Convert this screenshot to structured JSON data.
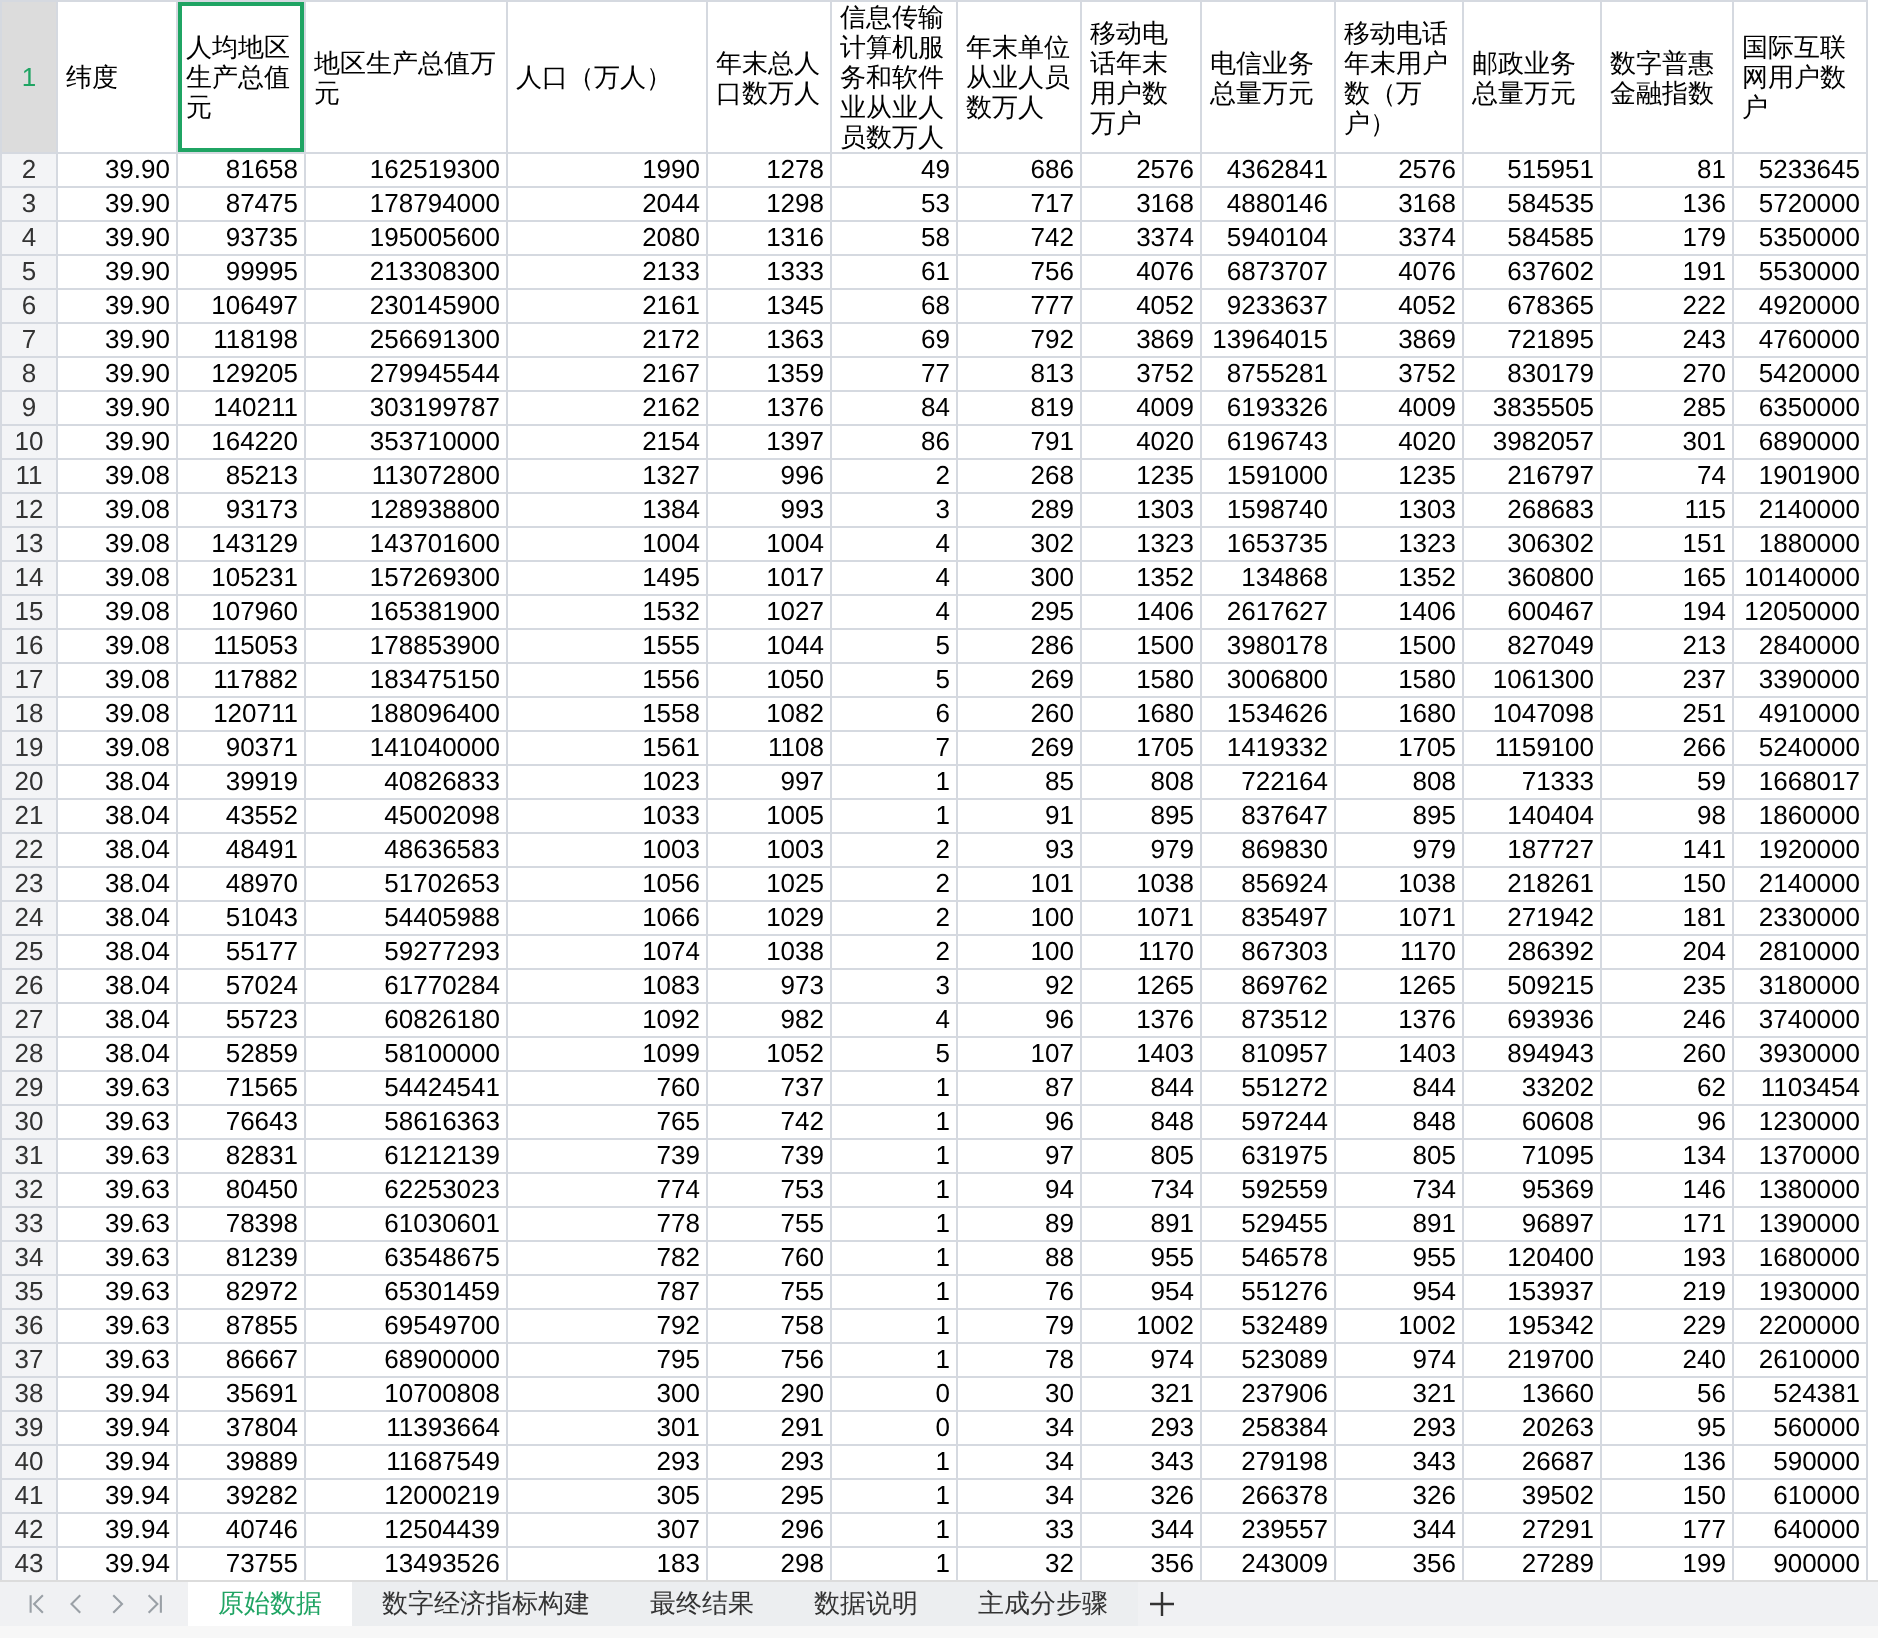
{
  "header_row": {
    "number": "1",
    "selected": true
  },
  "columns": [
    {
      "label": "纬度",
      "selected": false
    },
    {
      "label": "人均地区生产总值元",
      "selected": true
    },
    {
      "label": "地区生产总值万元",
      "selected": false
    },
    {
      "label": "人口（万人）",
      "selected": false
    },
    {
      "label": "年末总人口数万人",
      "selected": false
    },
    {
      "label": "信息传输计算机服务和软件业从业人员数万人",
      "selected": false
    },
    {
      "label": "年末单位从业人员数万人",
      "selected": false
    },
    {
      "label": "移动电话年末用户数万户",
      "selected": false
    },
    {
      "label": "电信业务总量万元",
      "selected": false
    },
    {
      "label": "移动电话年末用户数（万户）",
      "selected": false
    },
    {
      "label": "邮政业务总量万元",
      "selected": false
    },
    {
      "label": "数字普惠金融指数",
      "selected": false
    },
    {
      "label": "国际互联网用户数户",
      "selected": false
    }
  ],
  "rows": [
    {
      "number": "2",
      "cells": [
        "39.90",
        "81658",
        "162519300",
        "1990",
        "1278",
        "49",
        "686",
        "2576",
        "4362841",
        "2576",
        "515951",
        "81",
        "5233645"
      ]
    },
    {
      "number": "3",
      "cells": [
        "39.90",
        "87475",
        "178794000",
        "2044",
        "1298",
        "53",
        "717",
        "3168",
        "4880146",
        "3168",
        "584535",
        "136",
        "5720000"
      ]
    },
    {
      "number": "4",
      "cells": [
        "39.90",
        "93735",
        "195005600",
        "2080",
        "1316",
        "58",
        "742",
        "3374",
        "5940104",
        "3374",
        "584585",
        "179",
        "5350000"
      ]
    },
    {
      "number": "5",
      "cells": [
        "39.90",
        "99995",
        "213308300",
        "2133",
        "1333",
        "61",
        "756",
        "4076",
        "6873707",
        "4076",
        "637602",
        "191",
        "5530000"
      ]
    },
    {
      "number": "6",
      "cells": [
        "39.90",
        "106497",
        "230145900",
        "2161",
        "1345",
        "68",
        "777",
        "4052",
        "9233637",
        "4052",
        "678365",
        "222",
        "4920000"
      ]
    },
    {
      "number": "7",
      "cells": [
        "39.90",
        "118198",
        "256691300",
        "2172",
        "1363",
        "69",
        "792",
        "3869",
        "13964015",
        "3869",
        "721895",
        "243",
        "4760000"
      ]
    },
    {
      "number": "8",
      "cells": [
        "39.90",
        "129205",
        "279945544",
        "2167",
        "1359",
        "77",
        "813",
        "3752",
        "8755281",
        "3752",
        "830179",
        "270",
        "5420000"
      ]
    },
    {
      "number": "9",
      "cells": [
        "39.90",
        "140211",
        "303199787",
        "2162",
        "1376",
        "84",
        "819",
        "4009",
        "6193326",
        "4009",
        "3835505",
        "285",
        "6350000"
      ]
    },
    {
      "number": "10",
      "cells": [
        "39.90",
        "164220",
        "353710000",
        "2154",
        "1397",
        "86",
        "791",
        "4020",
        "6196743",
        "4020",
        "3982057",
        "301",
        "6890000"
      ]
    },
    {
      "number": "11",
      "cells": [
        "39.08",
        "85213",
        "113072800",
        "1327",
        "996",
        "2",
        "268",
        "1235",
        "1591000",
        "1235",
        "216797",
        "74",
        "1901900"
      ]
    },
    {
      "number": "12",
      "cells": [
        "39.08",
        "93173",
        "128938800",
        "1384",
        "993",
        "3",
        "289",
        "1303",
        "1598740",
        "1303",
        "268683",
        "115",
        "2140000"
      ]
    },
    {
      "number": "13",
      "cells": [
        "39.08",
        "143129",
        "143701600",
        "1004",
        "1004",
        "4",
        "302",
        "1323",
        "1653735",
        "1323",
        "306302",
        "151",
        "1880000"
      ]
    },
    {
      "number": "14",
      "cells": [
        "39.08",
        "105231",
        "157269300",
        "1495",
        "1017",
        "4",
        "300",
        "1352",
        "134868",
        "1352",
        "360800",
        "165",
        "10140000"
      ]
    },
    {
      "number": "15",
      "cells": [
        "39.08",
        "107960",
        "165381900",
        "1532",
        "1027",
        "4",
        "295",
        "1406",
        "2617627",
        "1406",
        "600467",
        "194",
        "12050000"
      ]
    },
    {
      "number": "16",
      "cells": [
        "39.08",
        "115053",
        "178853900",
        "1555",
        "1044",
        "5",
        "286",
        "1500",
        "3980178",
        "1500",
        "827049",
        "213",
        "2840000"
      ]
    },
    {
      "number": "17",
      "cells": [
        "39.08",
        "117882",
        "183475150",
        "1556",
        "1050",
        "5",
        "269",
        "1580",
        "3006800",
        "1580",
        "1061300",
        "237",
        "3390000"
      ]
    },
    {
      "number": "18",
      "cells": [
        "39.08",
        "120711",
        "188096400",
        "1558",
        "1082",
        "6",
        "260",
        "1680",
        "1534626",
        "1680",
        "1047098",
        "251",
        "4910000"
      ]
    },
    {
      "number": "19",
      "cells": [
        "39.08",
        "90371",
        "141040000",
        "1561",
        "1108",
        "7",
        "269",
        "1705",
        "1419332",
        "1705",
        "1159100",
        "266",
        "5240000"
      ]
    },
    {
      "number": "20",
      "cells": [
        "38.04",
        "39919",
        "40826833",
        "1023",
        "997",
        "1",
        "85",
        "808",
        "722164",
        "808",
        "71333",
        "59",
        "1668017"
      ]
    },
    {
      "number": "21",
      "cells": [
        "38.04",
        "43552",
        "45002098",
        "1033",
        "1005",
        "1",
        "91",
        "895",
        "837647",
        "895",
        "140404",
        "98",
        "1860000"
      ]
    },
    {
      "number": "22",
      "cells": [
        "38.04",
        "48491",
        "48636583",
        "1003",
        "1003",
        "2",
        "93",
        "979",
        "869830",
        "979",
        "187727",
        "141",
        "1920000"
      ]
    },
    {
      "number": "23",
      "cells": [
        "38.04",
        "48970",
        "51702653",
        "1056",
        "1025",
        "2",
        "101",
        "1038",
        "856924",
        "1038",
        "218261",
        "150",
        "2140000"
      ]
    },
    {
      "number": "24",
      "cells": [
        "38.04",
        "51043",
        "54405988",
        "1066",
        "1029",
        "2",
        "100",
        "1071",
        "835497",
        "1071",
        "271942",
        "181",
        "2330000"
      ]
    },
    {
      "number": "25",
      "cells": [
        "38.04",
        "55177",
        "59277293",
        "1074",
        "1038",
        "2",
        "100",
        "1170",
        "867303",
        "1170",
        "286392",
        "204",
        "2810000"
      ]
    },
    {
      "number": "26",
      "cells": [
        "38.04",
        "57024",
        "61770284",
        "1083",
        "973",
        "3",
        "92",
        "1265",
        "869762",
        "1265",
        "509215",
        "235",
        "3180000"
      ]
    },
    {
      "number": "27",
      "cells": [
        "38.04",
        "55723",
        "60826180",
        "1092",
        "982",
        "4",
        "96",
        "1376",
        "873512",
        "1376",
        "693936",
        "246",
        "3740000"
      ]
    },
    {
      "number": "28",
      "cells": [
        "38.04",
        "52859",
        "58100000",
        "1099",
        "1052",
        "5",
        "107",
        "1403",
        "810957",
        "1403",
        "894943",
        "260",
        "3930000"
      ]
    },
    {
      "number": "29",
      "cells": [
        "39.63",
        "71565",
        "54424541",
        "760",
        "737",
        "1",
        "87",
        "844",
        "551272",
        "844",
        "33202",
        "62",
        "1103454"
      ]
    },
    {
      "number": "30",
      "cells": [
        "39.63",
        "76643",
        "58616363",
        "765",
        "742",
        "1",
        "96",
        "848",
        "597244",
        "848",
        "60608",
        "96",
        "1230000"
      ]
    },
    {
      "number": "31",
      "cells": [
        "39.63",
        "82831",
        "61212139",
        "739",
        "739",
        "1",
        "97",
        "805",
        "631975",
        "805",
        "71095",
        "134",
        "1370000"
      ]
    },
    {
      "number": "32",
      "cells": [
        "39.63",
        "80450",
        "62253023",
        "774",
        "753",
        "1",
        "94",
        "734",
        "592559",
        "734",
        "95369",
        "146",
        "1380000"
      ]
    },
    {
      "number": "33",
      "cells": [
        "39.63",
        "78398",
        "61030601",
        "778",
        "755",
        "1",
        "89",
        "891",
        "529455",
        "891",
        "96897",
        "171",
        "1390000"
      ]
    },
    {
      "number": "34",
      "cells": [
        "39.63",
        "81239",
        "63548675",
        "782",
        "760",
        "1",
        "88",
        "955",
        "546578",
        "955",
        "120400",
        "193",
        "1680000"
      ]
    },
    {
      "number": "35",
      "cells": [
        "39.63",
        "82972",
        "65301459",
        "787",
        "755",
        "1",
        "76",
        "954",
        "551276",
        "954",
        "153937",
        "219",
        "1930000"
      ]
    },
    {
      "number": "36",
      "cells": [
        "39.63",
        "87855",
        "69549700",
        "792",
        "758",
        "1",
        "79",
        "1002",
        "532489",
        "1002",
        "195342",
        "229",
        "2200000"
      ]
    },
    {
      "number": "37",
      "cells": [
        "39.63",
        "86667",
        "68900000",
        "795",
        "756",
        "1",
        "78",
        "974",
        "523089",
        "974",
        "219700",
        "240",
        "2610000"
      ]
    },
    {
      "number": "38",
      "cells": [
        "39.94",
        "35691",
        "10700808",
        "300",
        "290",
        "0",
        "30",
        "321",
        "237906",
        "321",
        "13660",
        "56",
        "524381"
      ]
    },
    {
      "number": "39",
      "cells": [
        "39.94",
        "37804",
        "11393664",
        "301",
        "291",
        "0",
        "34",
        "293",
        "258384",
        "293",
        "20263",
        "95",
        "560000"
      ]
    },
    {
      "number": "40",
      "cells": [
        "39.94",
        "39889",
        "11687549",
        "293",
        "293",
        "1",
        "34",
        "343",
        "279198",
        "343",
        "26687",
        "136",
        "590000"
      ]
    },
    {
      "number": "41",
      "cells": [
        "39.94",
        "39282",
        "12000219",
        "305",
        "295",
        "1",
        "34",
        "326",
        "266378",
        "326",
        "39502",
        "150",
        "610000"
      ]
    },
    {
      "number": "42",
      "cells": [
        "39.94",
        "40746",
        "12504439",
        "307",
        "296",
        "1",
        "33",
        "344",
        "239557",
        "344",
        "27291",
        "177",
        "640000"
      ]
    },
    {
      "number": "43",
      "cells": [
        "39.94",
        "73755",
        "13493526",
        "183",
        "298",
        "1",
        "32",
        "356",
        "243009",
        "356",
        "27289",
        "199",
        "900000"
      ]
    }
  ],
  "sheet_tabs": [
    {
      "label": "原始数据",
      "selected": true
    },
    {
      "label": "数字经济指标构建",
      "selected": false
    },
    {
      "label": "最终结果",
      "selected": false
    },
    {
      "label": "数据说明",
      "selected": false
    },
    {
      "label": "主成分步骤",
      "selected": false
    }
  ]
}
